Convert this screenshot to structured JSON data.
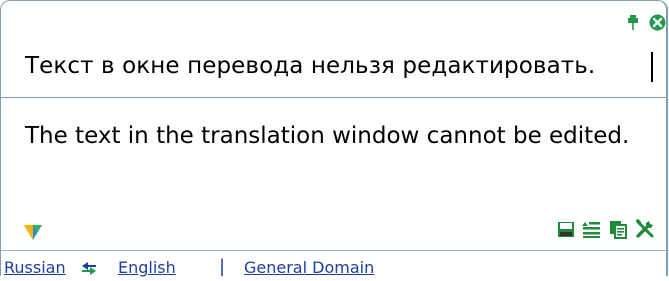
{
  "source": {
    "text": "Текст в окне перевода нельзя редактировать."
  },
  "translation": {
    "text": "The text in the translation window cannot be edited."
  },
  "status": {
    "source_language": "Russian",
    "target_language": "English",
    "separator": "|",
    "domain": "General Domain"
  },
  "icons": {
    "pin": "pin-icon",
    "close": "close-icon",
    "logo": "app-logo-icon",
    "tools": [
      "save-icon",
      "list-icon",
      "copy-icon",
      "settings-icon"
    ],
    "swap": "swap-languages-icon"
  },
  "colors": {
    "border": "#7f9db9",
    "link": "#1d3f9f",
    "tool_green": "#1f8a3a",
    "close_green": "#1f9a4a"
  }
}
